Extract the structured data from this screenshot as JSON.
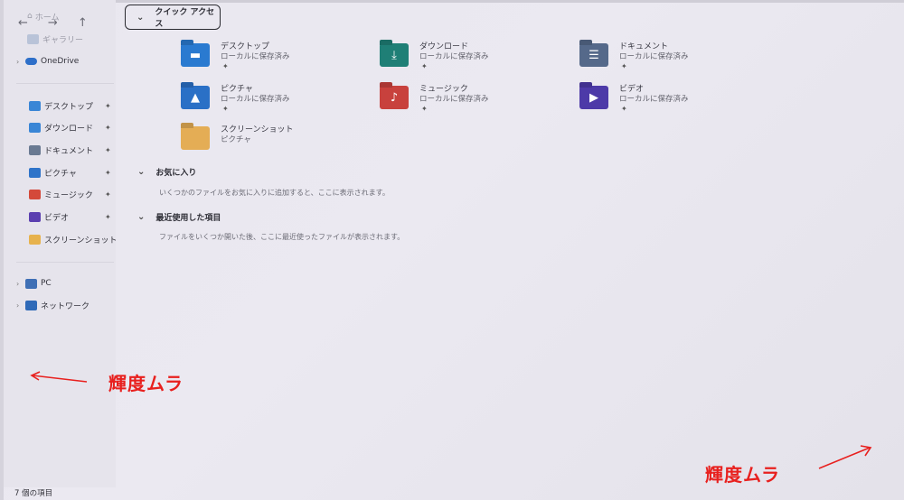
{
  "nav": {
    "home_label": "ホーム",
    "gallery_label": "ギャラリー",
    "back_glyph": "←",
    "forward_glyph": "→",
    "up_glyph": "↑"
  },
  "sidebar": {
    "onedrive": "OneDrive",
    "pinned": [
      {
        "label": "デスクトップ",
        "icon": "desktop-icon",
        "color": "#3a86d6",
        "pinned": true
      },
      {
        "label": "ダウンロード",
        "icon": "download-icon",
        "color": "#3a86d6",
        "pinned": true
      },
      {
        "label": "ドキュメント",
        "icon": "document-icon",
        "color": "#6a7a92",
        "pinned": true
      },
      {
        "label": "ピクチャ",
        "icon": "pictures-icon",
        "color": "#2f74c9",
        "pinned": true
      },
      {
        "label": "ミュージック",
        "icon": "music-icon",
        "color": "#d4493a",
        "pinned": true
      },
      {
        "label": "ビデオ",
        "icon": "video-icon",
        "color": "#5b3fb0",
        "pinned": true
      },
      {
        "label": "スクリーンショット",
        "icon": "folder-icon",
        "color": "#e7b24d",
        "pinned": false
      }
    ],
    "pc": "PC",
    "network": "ネットワーク",
    "pin_glyph": "📌"
  },
  "quick_access": {
    "title": "クイック アクセス",
    "tiles": [
      {
        "name": "デスクトップ",
        "sub": "ローカルに保存済み",
        "icon": "desktop-folder-icon",
        "color": "#2a7ad0",
        "glyph": "▬",
        "pinned": true
      },
      {
        "name": "ダウンロード",
        "sub": "ローカルに保存済み",
        "icon": "download-folder-icon",
        "color": "#1f7f76",
        "glyph": "⤓",
        "pinned": true
      },
      {
        "name": "ドキュメント",
        "sub": "ローカルに保存済み",
        "icon": "document-folder-icon",
        "color": "#55698a",
        "glyph": "☰",
        "pinned": true
      },
      {
        "name": "ピクチャ",
        "sub": "ローカルに保存済み",
        "icon": "pictures-folder-icon",
        "color": "#2a70c6",
        "glyph": "▲",
        "pinned": true
      },
      {
        "name": "ミュージック",
        "sub": "ローカルに保存済み",
        "icon": "music-folder-icon",
        "color": "#c8413d",
        "glyph": "♪",
        "pinned": true
      },
      {
        "name": "ビデオ",
        "sub": "ローカルに保存済み",
        "icon": "video-folder-icon",
        "color": "#4d3aa8",
        "glyph": "▶",
        "pinned": true
      },
      {
        "name": "スクリーンショット",
        "sub": "ピクチャ",
        "icon": "screenshot-folder-icon",
        "color": "#e4ad55",
        "glyph": "",
        "pinned": false
      }
    ]
  },
  "favorites": {
    "title": "お気に入り",
    "note": "いくつかのファイルをお気に入りに追加すると、ここに表示されます。"
  },
  "recent": {
    "title": "最近使用した項目",
    "note": "ファイルをいくつか開いた後、ここに最近使ったファイルが表示されます。"
  },
  "status": {
    "items": "7 個の項目"
  },
  "annotations": {
    "left": "輝度ムラ",
    "right": "輝度ムラ",
    "color": "#e8201e"
  }
}
